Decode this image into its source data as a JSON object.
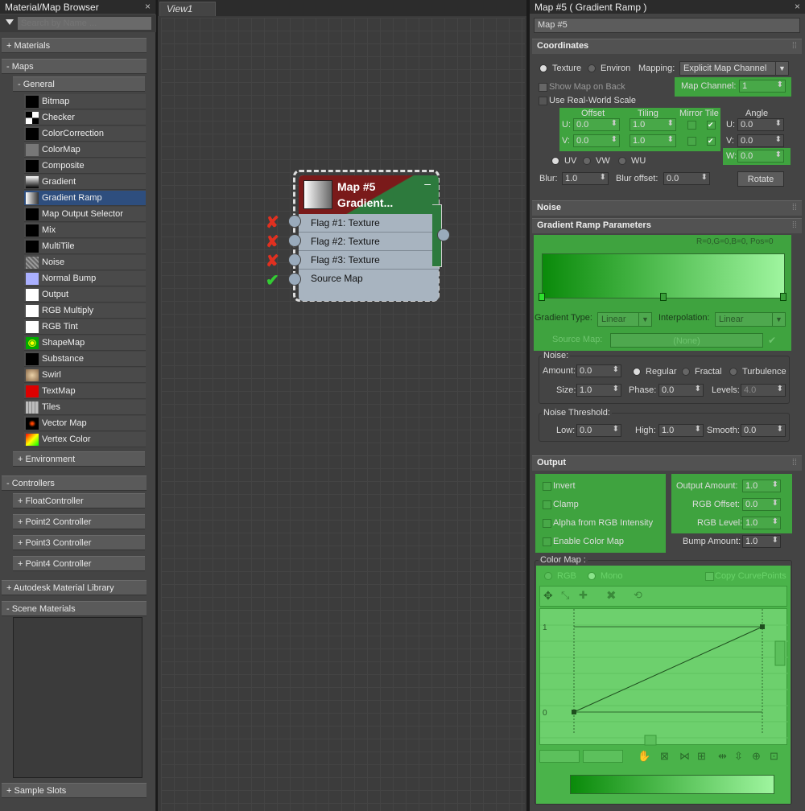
{
  "browser": {
    "title": "Material/Map Browser",
    "close": "×",
    "search_placeholder": "Search by Name ...",
    "materials": "+ Materials",
    "maps": "- Maps",
    "general": "- General",
    "items": [
      "Bitmap",
      "Checker",
      "ColorCorrection",
      "ColorMap",
      "Composite",
      "Gradient",
      "Gradient Ramp",
      "Map Output Selector",
      "Mix",
      "MultiTile",
      "Noise",
      "Normal Bump",
      "Output",
      "RGB Multiply",
      "RGB Tint",
      "ShapeMap",
      "Substance",
      "Swirl",
      "TextMap",
      "Tiles",
      "Vector Map",
      "Vertex Color"
    ],
    "selected_item": "Gradient Ramp",
    "environment": "+ Environment",
    "controllers": "- Controllers",
    "float_controller": "+ FloatController",
    "point2": "+ Point2 Controller",
    "point3": "+ Point3 Controller",
    "point4": "+ Point4 Controller",
    "autodesk": "+ Autodesk Material Library",
    "scene": "- Scene Materials",
    "sample_slots": "+ Sample Slots"
  },
  "view": {
    "tab": "View1",
    "node": {
      "title1": "Map #5",
      "title2": "Gradient...",
      "minimize": "–",
      "slots": [
        "Flag #1: Texture",
        "Flag #2: Texture",
        "Flag #3: Texture",
        "Source Map"
      ],
      "slot_status": [
        "✘",
        "✘",
        "✘",
        "✔"
      ]
    }
  },
  "panel": {
    "title": "Map #5  ( Gradient Ramp )",
    "close": "×",
    "name": "Map #5",
    "coordinates": {
      "header": "Coordinates",
      "texture": "Texture",
      "environ": "Environ",
      "mapping_label": "Mapping:",
      "mapping_value": "Explicit Map Channel",
      "show_map_on_back": "Show Map on Back",
      "map_channel_label": "Map Channel:",
      "map_channel_value": "1",
      "use_real_world": "Use Real-World Scale",
      "offset": "Offset",
      "tiling": "Tiling",
      "mirror_tile": "Mirror Tile",
      "angle": "Angle",
      "u": "U:",
      "v": "V:",
      "w": "W:",
      "u_offset": "0.0",
      "v_offset": "0.0",
      "u_tiling": "1.0",
      "v_tiling": "1.0",
      "u_angle": "0.0",
      "v_angle": "0.0",
      "w_angle": "0.0",
      "uv": "UV",
      "vw": "VW",
      "wu": "WU",
      "blur_label": "Blur:",
      "blur_value": "1.0",
      "blur_offset_label": "Blur offset:",
      "blur_offset_value": "0.0",
      "rotate": "Rotate"
    },
    "noise_header": "Noise",
    "gradient": {
      "header": "Gradient Ramp Parameters",
      "readout": "R=0,G=0,B=0, Pos=0",
      "gradient_type_label": "Gradient Type:",
      "gradient_type_value": "Linear",
      "interpolation_label": "Interpolation:",
      "interpolation_value": "Linear",
      "source_map_label": "Source Map:",
      "source_map_value": "(None)",
      "noise_group": "Noise:",
      "amount_label": "Amount:",
      "amount_value": "0.0",
      "regular": "Regular",
      "fractal": "Fractal",
      "turbulence": "Turbulence",
      "size_label": "Size:",
      "size_value": "1.0",
      "phase_label": "Phase:",
      "phase_value": "0.0",
      "levels_label": "Levels:",
      "levels_value": "4.0",
      "threshold_group": "Noise Threshold:",
      "low_label": "Low:",
      "low_value": "0.0",
      "high_label": "High:",
      "high_value": "1.0",
      "smooth_label": "Smooth:",
      "smooth_value": "0.0"
    },
    "output": {
      "header": "Output",
      "invert": "Invert",
      "clamp": "Clamp",
      "alpha_from_rgb": "Alpha from RGB Intensity",
      "enable_color_map": "Enable Color Map",
      "output_amount_label": "Output Amount:",
      "output_amount_value": "1.0",
      "rgb_offset_label": "RGB Offset:",
      "rgb_offset_value": "0.0",
      "rgb_level_label": "RGB Level:",
      "rgb_level_value": "1.0",
      "bump_amount_label": "Bump Amount:",
      "bump_amount_value": "1.0",
      "color_map_label": "Color Map :",
      "rgb": "RGB",
      "mono": "Mono",
      "copy_curve_points": "Copy CurvePoints",
      "axis_1": "1",
      "axis_0": "0"
    },
    "dots": "⁞⁞",
    "colors": {
      "green": "#3fa33f",
      "node_red": "#7a1a1a",
      "selection_blue": "#2e4e7e"
    }
  }
}
